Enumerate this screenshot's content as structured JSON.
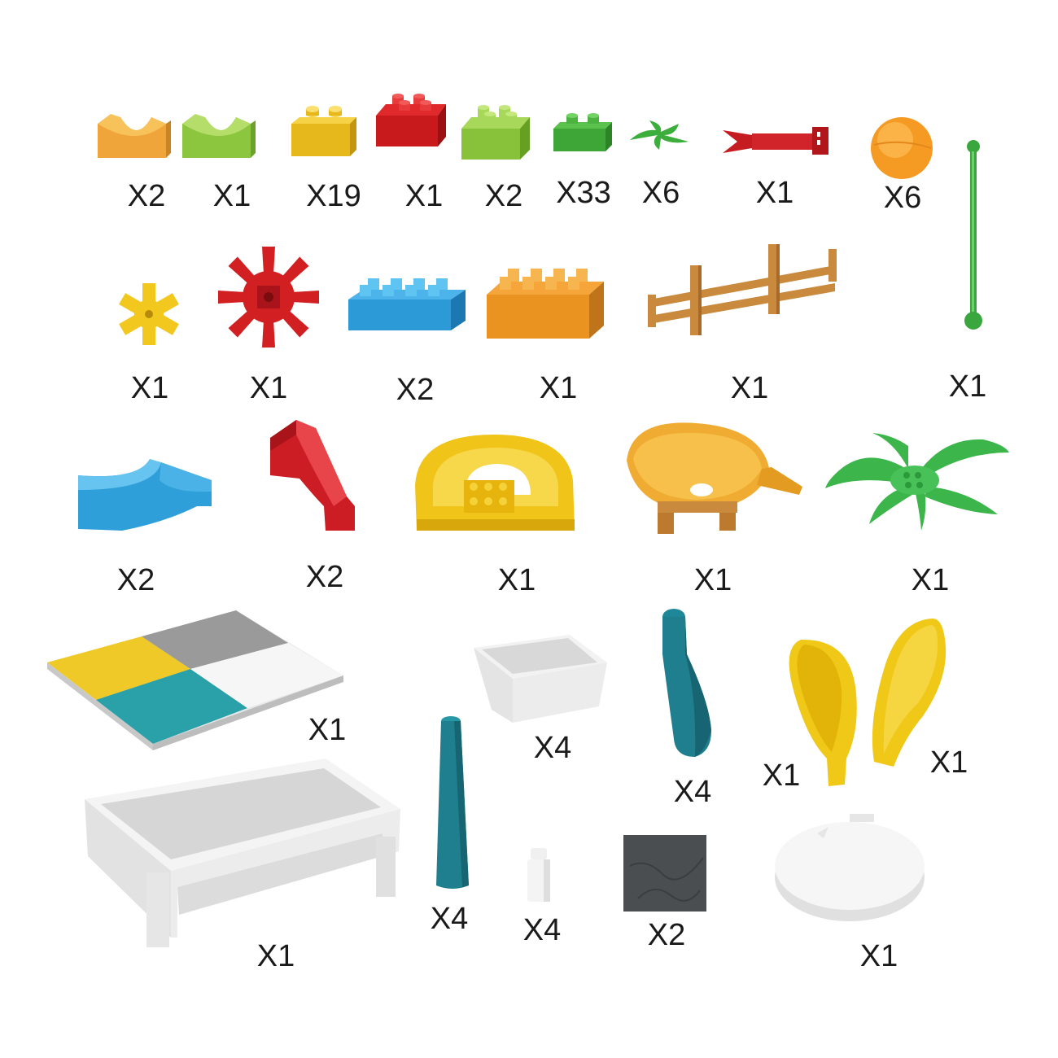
{
  "pieces": [
    {
      "name": "orange-curved-ramp-block",
      "qty": "X2"
    },
    {
      "name": "lime-curved-ramp-block",
      "qty": "X1"
    },
    {
      "name": "yellow-2x1-brick",
      "qty": "X19"
    },
    {
      "name": "red-2x2-brick",
      "qty": "X1"
    },
    {
      "name": "lime-2x2-brick",
      "qty": "X2"
    },
    {
      "name": "green-2x1-brick",
      "qty": "X33"
    },
    {
      "name": "green-small-leaf",
      "qty": "X6"
    },
    {
      "name": "red-clip-connector",
      "qty": "X1"
    },
    {
      "name": "orange-ball",
      "qty": "X6"
    },
    {
      "name": "yellow-small-gear",
      "qty": "X1"
    },
    {
      "name": "red-water-wheel",
      "qty": "X1"
    },
    {
      "name": "blue-4x2-brick",
      "qty": "X2"
    },
    {
      "name": "orange-4x2-brick",
      "qty": "X1"
    },
    {
      "name": "brown-fence",
      "qty": "X1"
    },
    {
      "name": "green-axle-rod",
      "qty": "X1"
    },
    {
      "name": "blue-curved-track",
      "qty": "X2"
    },
    {
      "name": "red-slide",
      "qty": "X2"
    },
    {
      "name": "yellow-u-turn-track",
      "qty": "X1"
    },
    {
      "name": "orange-funnel-bowl",
      "qty": "X1"
    },
    {
      "name": "green-palm-leaves",
      "qty": "X1"
    },
    {
      "name": "baseplate",
      "qty": "X1"
    },
    {
      "name": "small-white-tray",
      "qty": "X4"
    },
    {
      "name": "teal-curved-leg",
      "qty": "X4"
    },
    {
      "name": "yellow-ear-left",
      "qty": "X1"
    },
    {
      "name": "yellow-ear-right",
      "qty": "X1"
    },
    {
      "name": "large-white-tray",
      "qty": "X1"
    },
    {
      "name": "teal-straight-leg",
      "qty": "X4"
    },
    {
      "name": "white-peg",
      "qty": "X4"
    },
    {
      "name": "grey-foam-square",
      "qty": "X2"
    },
    {
      "name": "white-round-base",
      "qty": "X1"
    }
  ]
}
